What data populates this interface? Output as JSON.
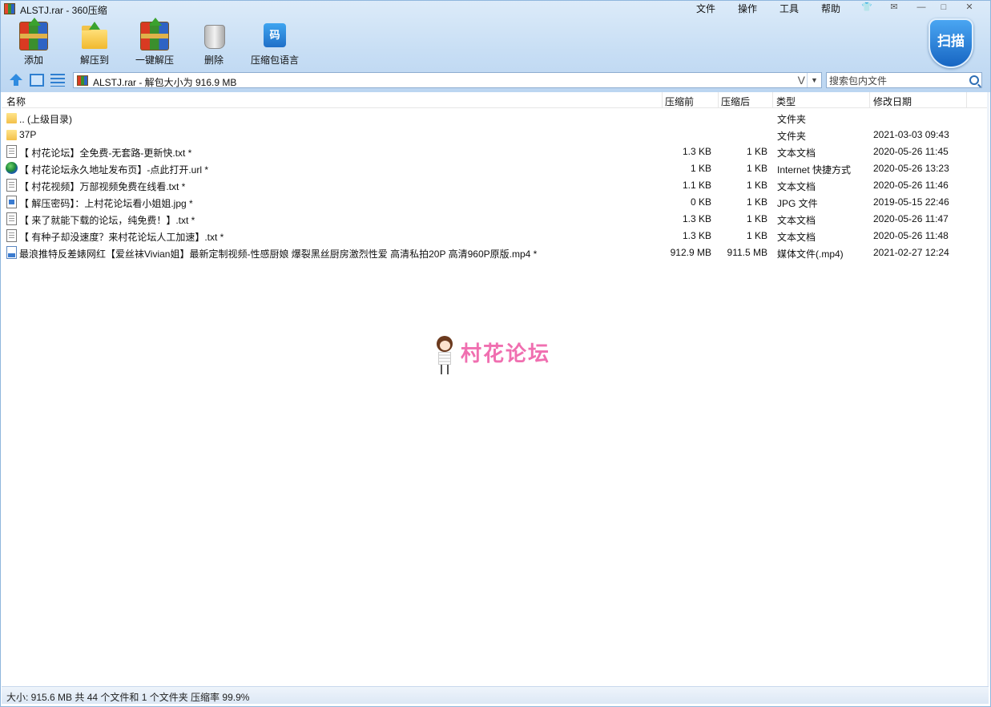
{
  "window": {
    "title": "ALSTJ.rar - 360压缩"
  },
  "menu": [
    "文件",
    "操作",
    "工具",
    "帮助"
  ],
  "toolbar": [
    {
      "label": "添加",
      "icon": "add-archive-icon"
    },
    {
      "label": "解压到",
      "icon": "extract-to-icon"
    },
    {
      "label": "一键解压",
      "icon": "one-click-extract-icon"
    },
    {
      "label": "删除",
      "icon": "delete-icon"
    },
    {
      "label": "压缩包语言",
      "icon": "archive-language-icon",
      "glyph": "码"
    }
  ],
  "scan_button": {
    "label": "扫描"
  },
  "address": {
    "path": "ALSTJ.rar - 解包大小为 916.9 MB",
    "search_placeholder": "搜索包内文件"
  },
  "columns": {
    "name": "名称",
    "compressed": "压缩前",
    "original": "压缩后",
    "type": "类型",
    "modified": "修改日期"
  },
  "files": [
    {
      "icon": "folder",
      "name": ".. (上级目录)",
      "compressed": "",
      "original": "",
      "type": "文件夹",
      "modified": ""
    },
    {
      "icon": "folder",
      "name": "37P",
      "compressed": "",
      "original": "",
      "type": "文件夹",
      "modified": "2021-03-03 09:43"
    },
    {
      "icon": "txt",
      "name": "【 村花论坛】全免费-无套路-更新快.txt *",
      "compressed": "1.3 KB",
      "original": "1 KB",
      "type": "文本文档",
      "modified": "2020-05-26 11:45"
    },
    {
      "icon": "url",
      "name": "【 村花论坛永久地址发布页】-点此打开.url *",
      "compressed": "1 KB",
      "original": "1 KB",
      "type": "Internet 快捷方式",
      "modified": "2020-05-26 13:23"
    },
    {
      "icon": "txt",
      "name": "【 村花视频】万部视频免费在线看.txt *",
      "compressed": "1.1 KB",
      "original": "1 KB",
      "type": "文本文档",
      "modified": "2020-05-26 11:46"
    },
    {
      "icon": "jpg",
      "name": "【 解压密码】：上村花论坛看小姐姐.jpg *",
      "compressed": "0 KB",
      "original": "1 KB",
      "type": "JPG 文件",
      "modified": "2019-05-15 22:46"
    },
    {
      "icon": "txt",
      "name": "【 来了就能下载的论坛，纯免费！】.txt *",
      "compressed": "1.3 KB",
      "original": "1 KB",
      "type": "文本文档",
      "modified": "2020-05-26 11:47"
    },
    {
      "icon": "txt",
      "name": "【 有种子却没速度？来村花论坛人工加速】.txt *",
      "compressed": "1.3 KB",
      "original": "1 KB",
      "type": "文本文档",
      "modified": "2020-05-26 11:48"
    },
    {
      "icon": "mp4",
      "name": "最浪推特反差婊网红【爱丝袜Vivian姐】最新定制视频-性感厨娘 爆裂黑丝厨房激烈性爱 高清私拍20P 高清960P原版.mp4 *",
      "compressed": "912.9 MB",
      "original": "911.5 MB",
      "type": "媒体文件(.mp4)",
      "modified": "2021-02-27 12:24"
    }
  ],
  "watermark": {
    "text": "村花论坛"
  },
  "status": {
    "text": "大小: 915.6 MB 共 44 个文件和 1 个文件夹 压缩率 99.9%"
  }
}
